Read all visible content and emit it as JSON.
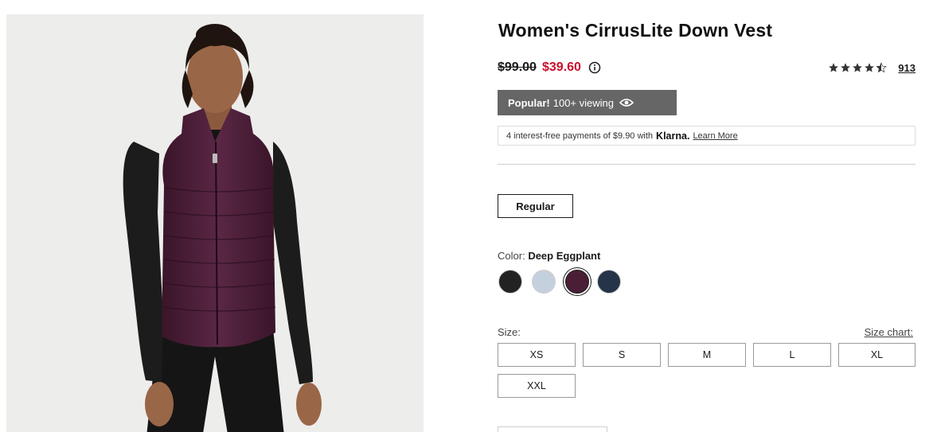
{
  "product": {
    "title": "Women's CirrusLite Down Vest",
    "original_price": "$99.00",
    "sale_price": "$39.60",
    "rating": 4.5,
    "review_count": "913"
  },
  "popularity": {
    "strong_text": "Popular!",
    "text": "100+ viewing"
  },
  "klarna": {
    "message": "4 interest-free payments of $9.90 with",
    "brand": "Klarna.",
    "link": "Learn More"
  },
  "fit": {
    "selected_label": "Regular"
  },
  "color": {
    "label": "Color:",
    "selected": "Deep Eggplant",
    "swatches": [
      {
        "name": "Black",
        "hex": "#222222"
      },
      {
        "name": "Light Blue",
        "hex": "#c5d0de"
      },
      {
        "name": "Deep Eggplant",
        "hex": "#4a1f36"
      },
      {
        "name": "Navy",
        "hex": "#253448"
      }
    ]
  },
  "size": {
    "label": "Size:",
    "chart_link": "Size chart:",
    "options": [
      "XS",
      "S",
      "M",
      "L",
      "XL",
      "XXL"
    ]
  },
  "colors": {
    "sale_red": "#c8102e",
    "popular_bg": "#666666"
  }
}
